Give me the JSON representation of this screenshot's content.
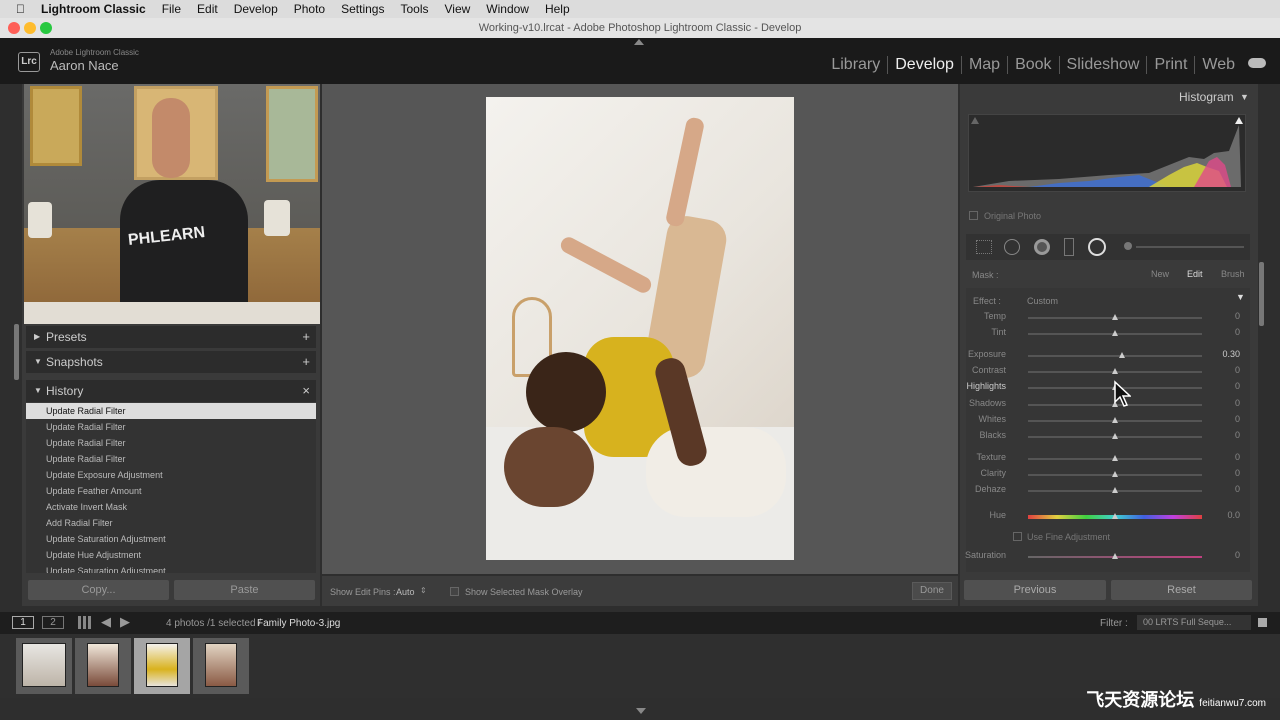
{
  "menubar": {
    "apple": "",
    "app": "Lightroom Classic",
    "items": [
      "File",
      "Edit",
      "Develop",
      "Photo",
      "Settings",
      "Tools",
      "View",
      "Window",
      "Help"
    ]
  },
  "window_title": "Working-v10.lrcat - Adobe Photoshop Lightroom Classic - Develop",
  "identity": {
    "badge": "Lrc",
    "product": "Adobe Lightroom Classic",
    "user": "Aaron Nace"
  },
  "modules": [
    "Library",
    "Develop",
    "Map",
    "Book",
    "Slideshow",
    "Print",
    "Web"
  ],
  "active_module": "Develop",
  "left": {
    "presets": "Presets",
    "snapshots": "Snapshots",
    "history": "History",
    "history_items": [
      "Update Radial Filter",
      "Update Radial Filter",
      "Update Radial Filter",
      "Update Radial Filter",
      "Update Exposure Adjustment",
      "Update Feather Amount",
      "Activate Invert Mask",
      "Add Radial Filter",
      "Update Saturation Adjustment",
      "Update Hue Adjustment",
      "Update Saturation Adjustment"
    ],
    "copy": "Copy...",
    "paste": "Paste"
  },
  "video": {
    "shirt_text": "PHLEARN"
  },
  "toolbar": {
    "show_edit_pins": "Show Edit Pins :",
    "edit_pins_value": "Auto",
    "mask_overlay": "Show Selected Mask Overlay",
    "done": "Done"
  },
  "right": {
    "histogram": "Histogram",
    "original_photo": "Original Photo",
    "mask": "Mask :",
    "mask_new": "New",
    "mask_edit": "Edit",
    "mask_brush": "Brush",
    "effect": "Effect :",
    "effect_value": "Custom",
    "sliders": [
      {
        "label": "Temp",
        "value": "0",
        "pos": 0.5
      },
      {
        "label": "Tint",
        "value": "0",
        "pos": 0.5
      },
      {
        "label": "Exposure",
        "value": "0.30",
        "pos": 0.54
      },
      {
        "label": "Contrast",
        "value": "0",
        "pos": 0.5
      },
      {
        "label": "Highlights",
        "value": "0",
        "pos": 0.5
      },
      {
        "label": "Shadows",
        "value": "0",
        "pos": 0.5
      },
      {
        "label": "Whites",
        "value": "0",
        "pos": 0.5
      },
      {
        "label": "Blacks",
        "value": "0",
        "pos": 0.5
      },
      {
        "label": "Texture",
        "value": "0",
        "pos": 0.5
      },
      {
        "label": "Clarity",
        "value": "0",
        "pos": 0.5
      },
      {
        "label": "Dehaze",
        "value": "0",
        "pos": 0.5
      },
      {
        "label": "Hue",
        "value": "0.0",
        "pos": 0.5
      },
      {
        "label": "Saturation",
        "value": "0",
        "pos": 0.5
      }
    ],
    "fine_adjust": "Use Fine Adjustment",
    "previous": "Previous",
    "reset": "Reset"
  },
  "filmstrip": {
    "page1": "1",
    "page2": "2",
    "info": "4 photos /1 selected /",
    "filename": "Family Photo-3.jpg",
    "filter": "Filter :",
    "filter_value": "00 LRTS Full Seque..."
  },
  "watermark": {
    "cn": "飞天资源论坛",
    "site": "feitianwu7.com"
  }
}
